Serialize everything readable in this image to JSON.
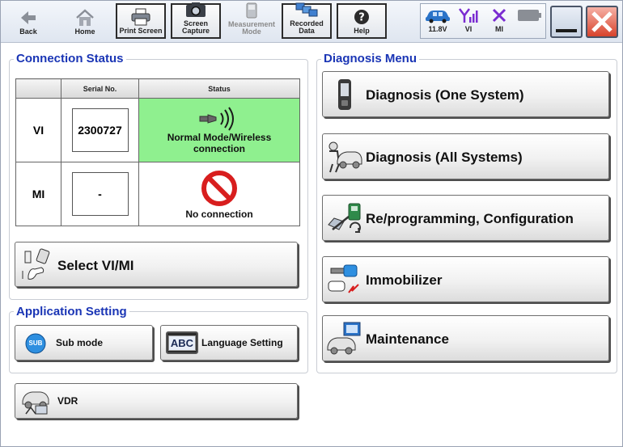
{
  "toolbar": {
    "back": "Back",
    "home": "Home",
    "print_screen": "Print Screen",
    "screen_capture": "Screen Capture",
    "measurement_mode": "Measurement Mode",
    "recorded_data": "Recorded Data",
    "help": "Help"
  },
  "status": {
    "voltage": "11.8V",
    "vi": "VI",
    "mi": "MI"
  },
  "connection": {
    "title": "Connection Status",
    "col_serial": "Serial No.",
    "col_status": "Status",
    "rows": [
      {
        "label": "VI",
        "serial": "2300727",
        "status": "Normal Mode/Wireless connection",
        "status_color": "#8ff08f"
      },
      {
        "label": "MI",
        "serial": "-",
        "status": "No connection",
        "status_color": "#ffffff"
      }
    ],
    "select_button": "Select VI/MI"
  },
  "application": {
    "title": "Application Setting",
    "sub_mode": "Sub mode",
    "sub_badge": "SUB",
    "language": "Language Setting",
    "language_badge": "ABC"
  },
  "vdr": {
    "label": "VDR"
  },
  "diagnosis": {
    "title": "Diagnosis Menu",
    "items": [
      {
        "label": "Diagnosis (One System)",
        "icon": "handheld-icon"
      },
      {
        "label": "Diagnosis (All Systems)",
        "icon": "mechanic-car-icon"
      },
      {
        "label": "Re/programming, Configuration",
        "icon": "reprogramming-icon"
      },
      {
        "label": "Immobilizer",
        "icon": "key-icon"
      },
      {
        "label": "Maintenance",
        "icon": "maintenance-icon"
      }
    ]
  },
  "colors": {
    "title_blue": "#1a35b5",
    "ok_green": "#8ff08f",
    "no_conn_red": "#d81e1e",
    "status_purple": "#7a2bd1"
  }
}
